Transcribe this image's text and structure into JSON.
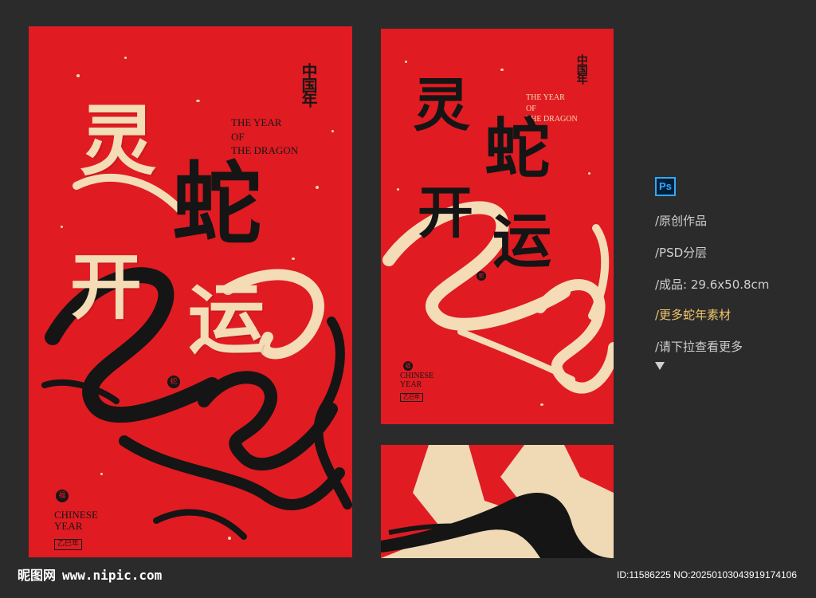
{
  "posters": {
    "main": {
      "brand": "中国年",
      "title_en": "THE YEAR\nOF\nTHE DRAGON",
      "headline": [
        "灵",
        "蛇",
        "开",
        "运"
      ],
      "footer_en": "CHINESE\nYEAR",
      "footer_tag": "乙巳年"
    },
    "side": {
      "brand": "中国年",
      "title_en": "THE YEAR\nOF\nTHE DRAGON",
      "headline": [
        "灵",
        "蛇",
        "开",
        "运"
      ],
      "footer_en": "CHINESE\nYEAR",
      "footer_tag": "乙巳年"
    }
  },
  "info_panel": {
    "software_icon": "Ps",
    "lines": [
      "/原创作品",
      "/PSD分层",
      "/成品: 29.6x50.8cm",
      "/更多蛇年素材",
      "/请下拉查看更多"
    ],
    "accent_color": "#f2c56b",
    "scroll_hint_icon": "down-triangle-icon"
  },
  "watermark": {
    "site_name": "昵图网",
    "url": "www.nipic.com"
  },
  "image_id": "ID:11586225 NO:20250103043919174106",
  "colors": {
    "background": "#2b2b2b",
    "poster_red": "#e11b22",
    "cream": "#f3dcb6",
    "ink": "#151515"
  }
}
